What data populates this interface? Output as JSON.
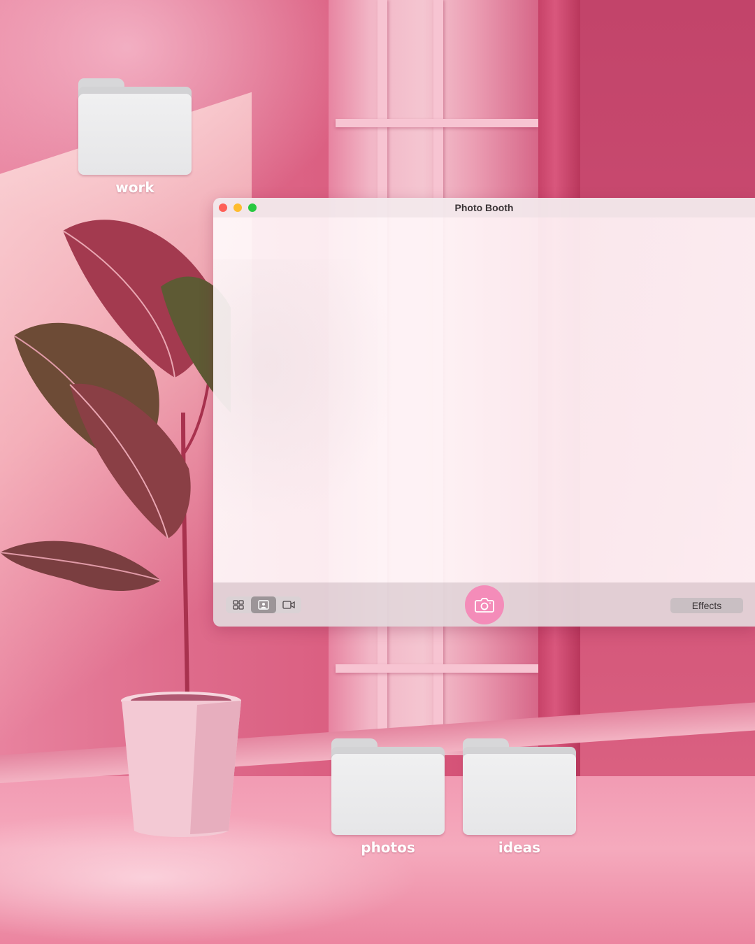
{
  "desktop": {
    "folders": [
      {
        "label": "work"
      },
      {
        "label": "photos"
      },
      {
        "label": "ideas"
      }
    ]
  },
  "window": {
    "title": "Photo Booth",
    "traffic_lights": [
      "close",
      "minimize",
      "zoom"
    ],
    "toolbar": {
      "view_modes": [
        "grid-icon",
        "single-photo-icon",
        "video-icon"
      ],
      "selected_view": "single-photo-icon",
      "shutter_icon": "camera-icon",
      "effects_label": "Effects"
    }
  },
  "colors": {
    "accent": "#f48cb9",
    "close": "#fe5f57",
    "minimize": "#febc2e",
    "zoom": "#28c840"
  }
}
